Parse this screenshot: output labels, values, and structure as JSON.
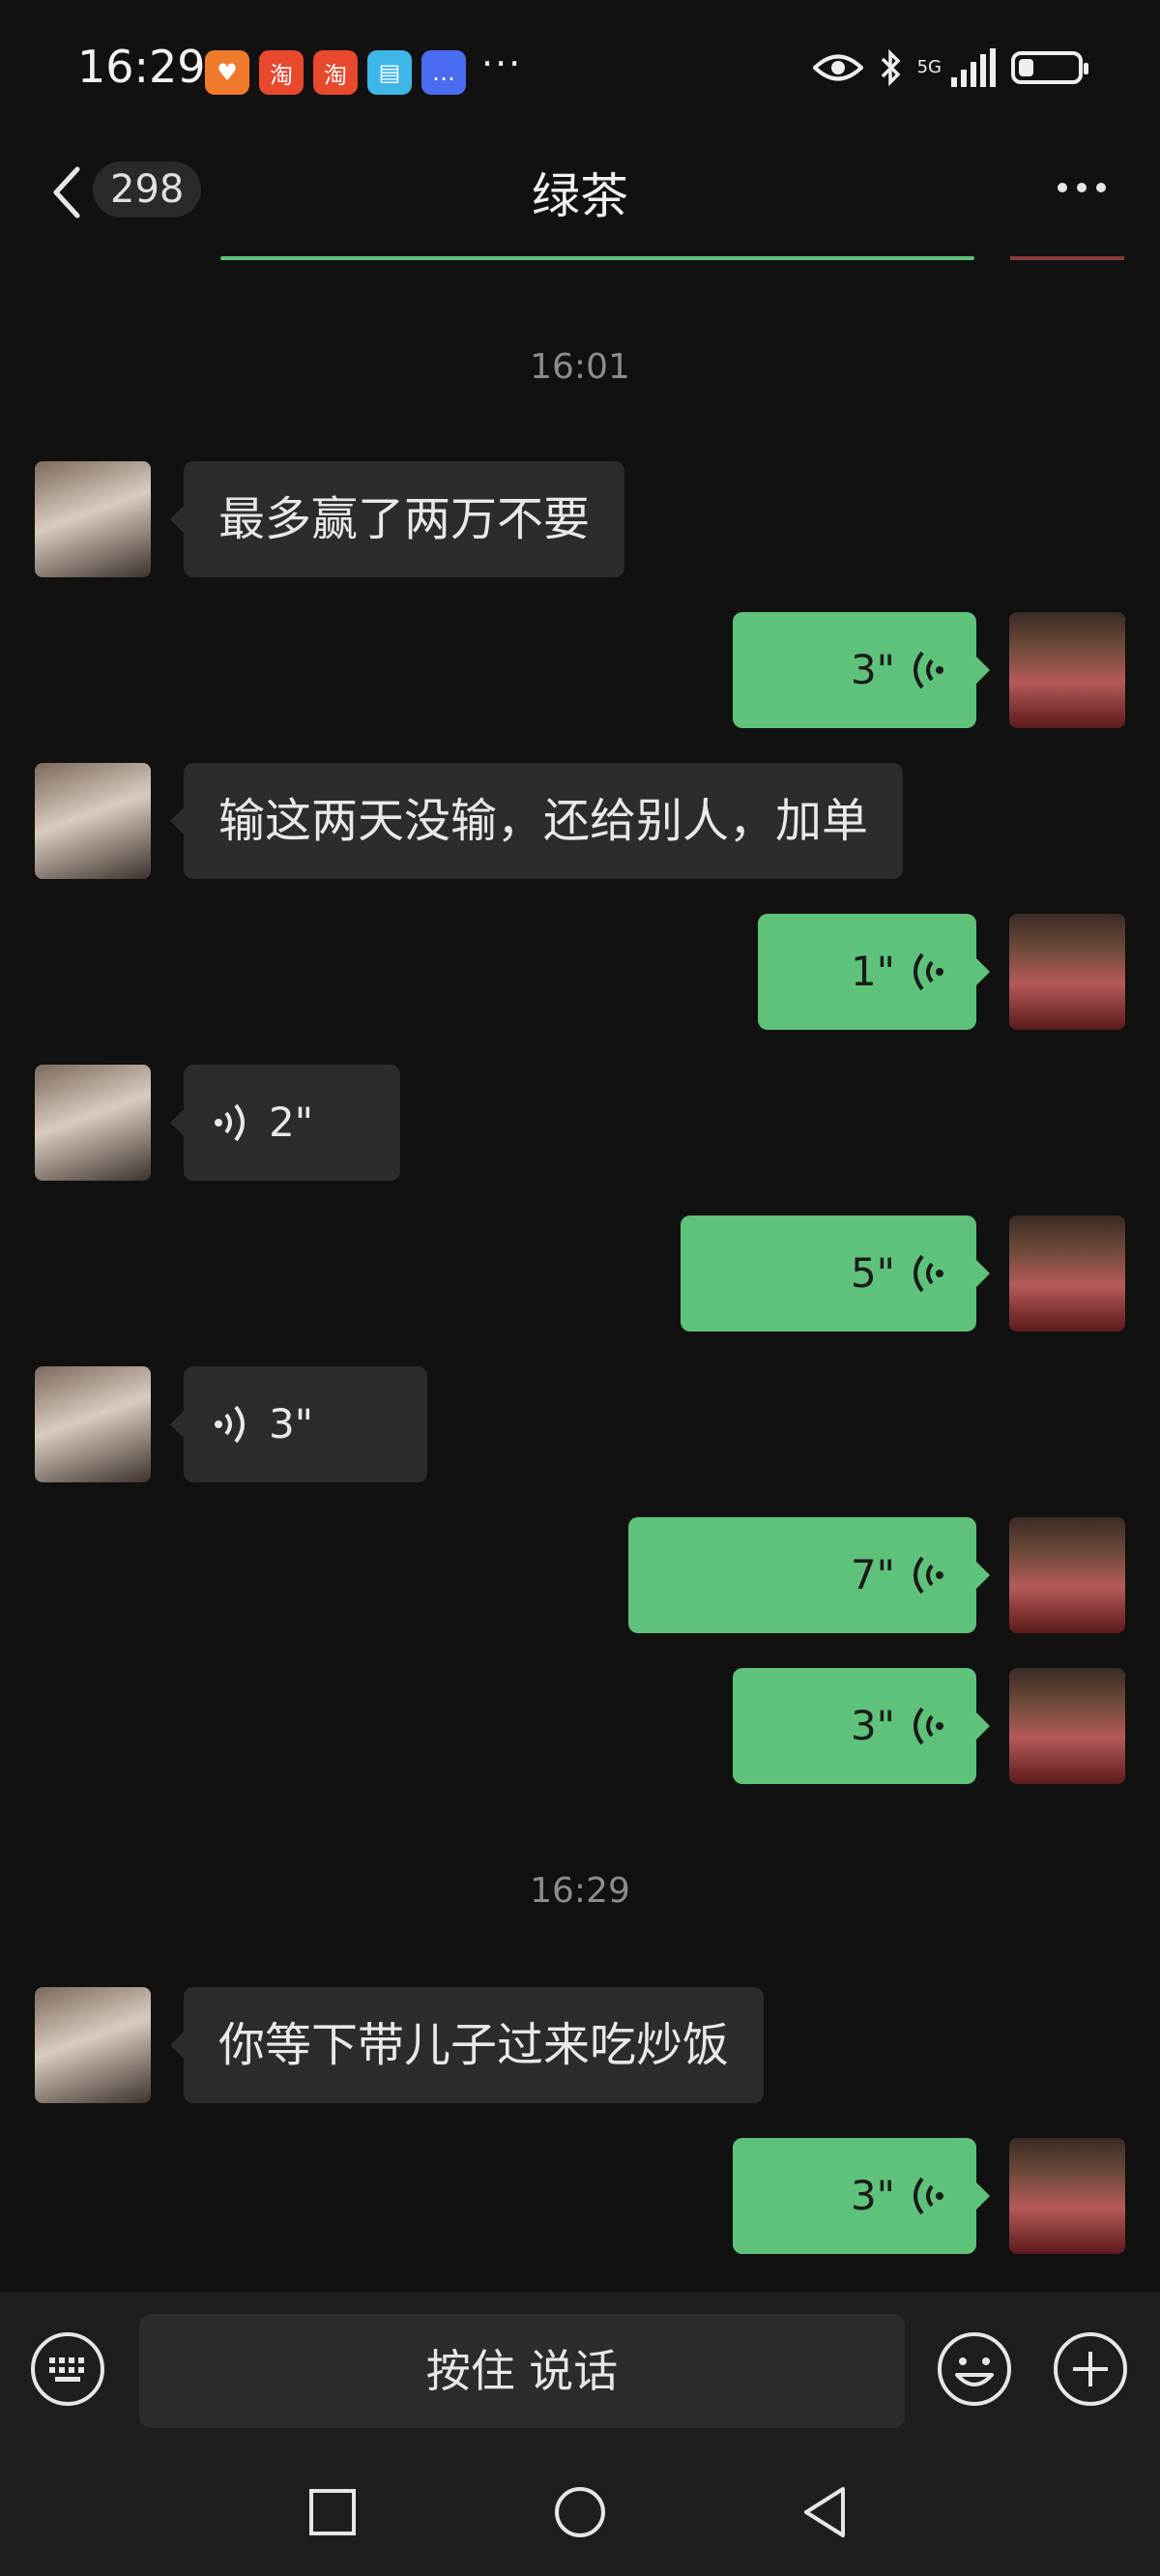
{
  "status_bar": {
    "time": "16:29",
    "app_icons": [
      {
        "name": "heart-app-icon",
        "glyph": "♥",
        "color": "#f07a2c"
      },
      {
        "name": "taobao-icon",
        "glyph": "淘",
        "color": "#e8482c"
      },
      {
        "name": "taobao-icon",
        "glyph": "淘",
        "color": "#e8482c"
      },
      {
        "name": "book-app-icon",
        "glyph": "▤",
        "color": "#3fb6e8"
      },
      {
        "name": "message-app-icon",
        "glyph": "…",
        "color": "#4a6cf0"
      }
    ],
    "more_dots": "···",
    "network": "5G",
    "battery_level": 0.25
  },
  "header": {
    "unread_count": "298",
    "title": "绿茶"
  },
  "messages": {
    "ts1": "16:01",
    "m1": "最多赢了两万不要",
    "m2": "3\"",
    "m3": "输这两天没输，还给别人，加单",
    "m4": "1\"",
    "m5": "2\"",
    "m6": "5\"",
    "m7": "3\"",
    "m8": "7\"",
    "m9": "3\"",
    "ts2": "16:29",
    "m10": "你等下带儿子过来吃炒饭",
    "m11": "3\""
  },
  "input_bar": {
    "hold_to_talk": "按住 说话"
  },
  "colors": {
    "background": "#111111",
    "outgoing_bubble": "#5ec27a",
    "incoming_bubble": "#2c2c2c"
  }
}
